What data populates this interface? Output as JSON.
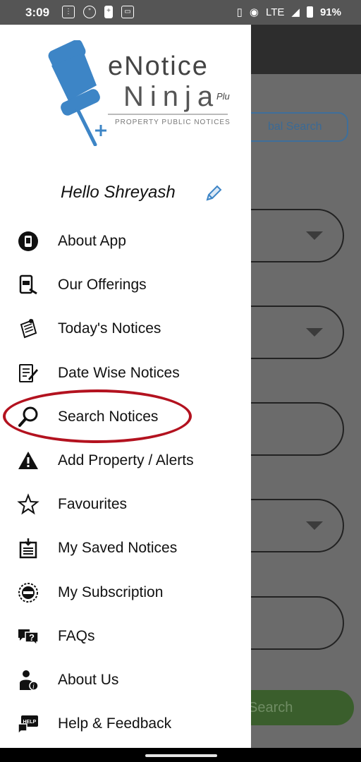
{
  "status_bar": {
    "time": "3:09",
    "network": "LTE",
    "battery": "91%"
  },
  "background": {
    "global_search_label": "bal Search",
    "search_button_label": "Search"
  },
  "drawer": {
    "logo": {
      "brand_top": "eNotice",
      "brand_bottom": "Ninja",
      "brand_suffix": "Plu",
      "tagline": "PROPERTY PUBLIC NOTICES"
    },
    "greeting": "Hello Shreyash",
    "menu": [
      {
        "label": "About App",
        "icon": "phone-app-icon"
      },
      {
        "label": "Our Offerings",
        "icon": "offerings-icon"
      },
      {
        "label": "Today's Notices",
        "icon": "notice-pin-icon"
      },
      {
        "label": "Date Wise Notices",
        "icon": "document-edit-icon"
      },
      {
        "label": "Search Notices",
        "icon": "search-icon"
      },
      {
        "label": "Add Property / Alerts",
        "icon": "alert-icon"
      },
      {
        "label": "Favourites",
        "icon": "star-icon"
      },
      {
        "label": "My Saved Notices",
        "icon": "saved-icon"
      },
      {
        "label": "My Subscription",
        "icon": "badge-icon"
      },
      {
        "label": "FAQs",
        "icon": "faq-icon"
      },
      {
        "label": "About Us",
        "icon": "info-user-icon"
      },
      {
        "label": "Help & Feedback",
        "icon": "help-chat-icon"
      }
    ],
    "highlighted_item": "Search Notices"
  },
  "colors": {
    "highlight_ring": "#b3121f",
    "pin_blue": "#3d85c6",
    "search_button": "#3a5e2c"
  }
}
